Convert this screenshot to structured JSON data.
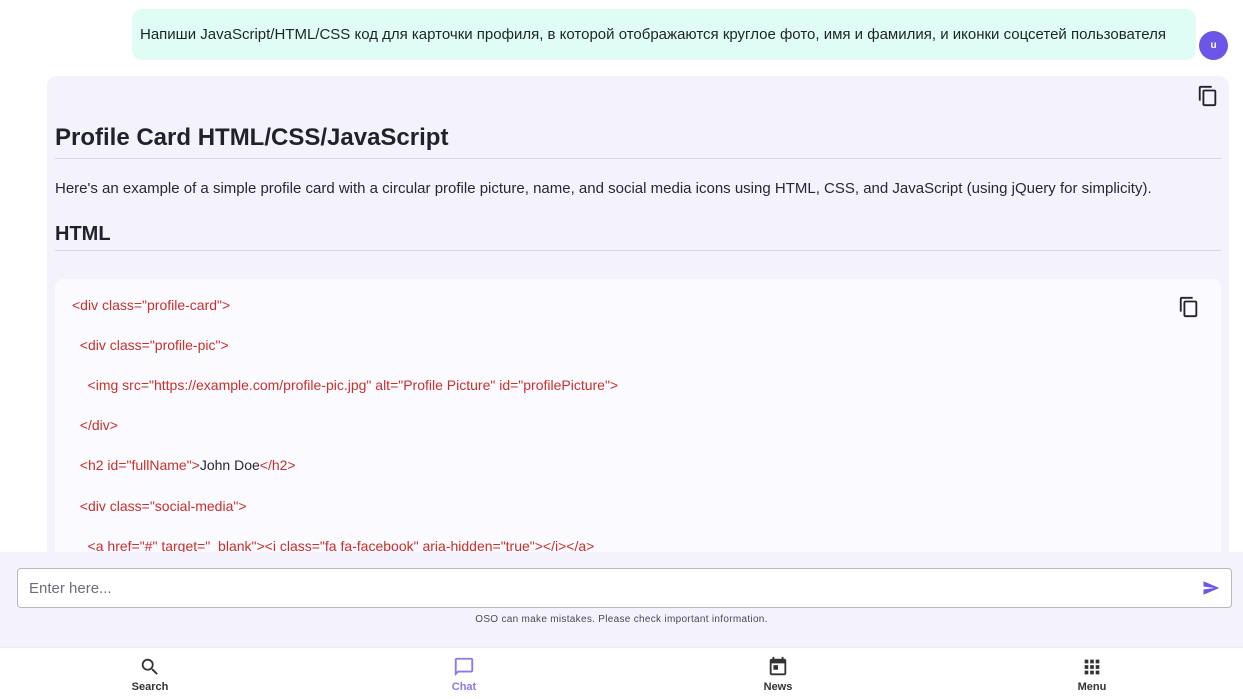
{
  "user_message": {
    "text": "Напиши JavaScript/HTML/CSS код для карточки профиля, в которой отображаются круглое фото, имя и фамилия, и иконки соцсетей пользователя",
    "avatar_letter": "u"
  },
  "bot_message": {
    "title": "Profile Card HTML/CSS/JavaScript",
    "intro": "Here's an example of a simple profile card with a circular profile picture, name, and social media icons using HTML, CSS, and JavaScript (using jQuery for simplicity).",
    "section_heading": "HTML",
    "code_lines": [
      {
        "tag": "<div class=\"profile-card\">",
        "text": "",
        "close": ""
      },
      {
        "tag": "  <div class=\"profile-pic\">",
        "text": "",
        "close": ""
      },
      {
        "tag": "    <img src=\"https://example.com/profile-pic.jpg\" alt=\"Profile Picture\" id=\"profilePicture\">",
        "text": "",
        "close": ""
      },
      {
        "tag": "  </div>",
        "text": "",
        "close": ""
      },
      {
        "tag": "  <h2 id=\"fullName\">",
        "text": "John Doe",
        "close": "</h2>"
      },
      {
        "tag": "  <div class=\"social-media\">",
        "text": "",
        "close": ""
      },
      {
        "tag": "    <a href=\"#\" target=\"_blank\"><i class=\"fa fa-facebook\" aria-hidden=\"true\"></i></a>",
        "text": "",
        "close": ""
      }
    ]
  },
  "input": {
    "placeholder": "Enter here...",
    "disclaimer": "OSO can make mistakes. Please check important information."
  },
  "nav": {
    "search": "Search",
    "chat": "Chat",
    "news": "News",
    "menu": "Menu"
  },
  "colors": {
    "accent": "#6c56e8",
    "active_nav": "#8a78e8",
    "code_tag": "#c7302b",
    "user_bubble": "#e0fdf5",
    "bot_bubble": "#f4f2fd"
  }
}
